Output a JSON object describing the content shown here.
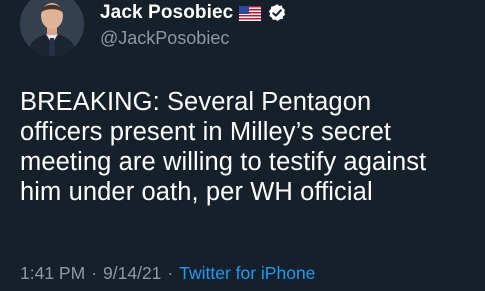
{
  "author": {
    "display_name": "Jack Posobiec",
    "handle": "@JackPosobiec",
    "flag_icon": "us-flag-icon",
    "verified_icon": "verified-badge-icon",
    "verified_color": "#ffffff"
  },
  "tweet": {
    "text": "BREAKING: Several Pentagon\nofficers present in Milley’s secret\nmeeting are willing to testify against\nhim under oath, per WH official"
  },
  "meta": {
    "time": "1:41 PM",
    "separator": "·",
    "date": "9/14/21",
    "source": "Twitter for iPhone"
  },
  "colors": {
    "background": "#15202b",
    "secondary_text": "#8b98a5",
    "link": "#1d9bf0"
  }
}
